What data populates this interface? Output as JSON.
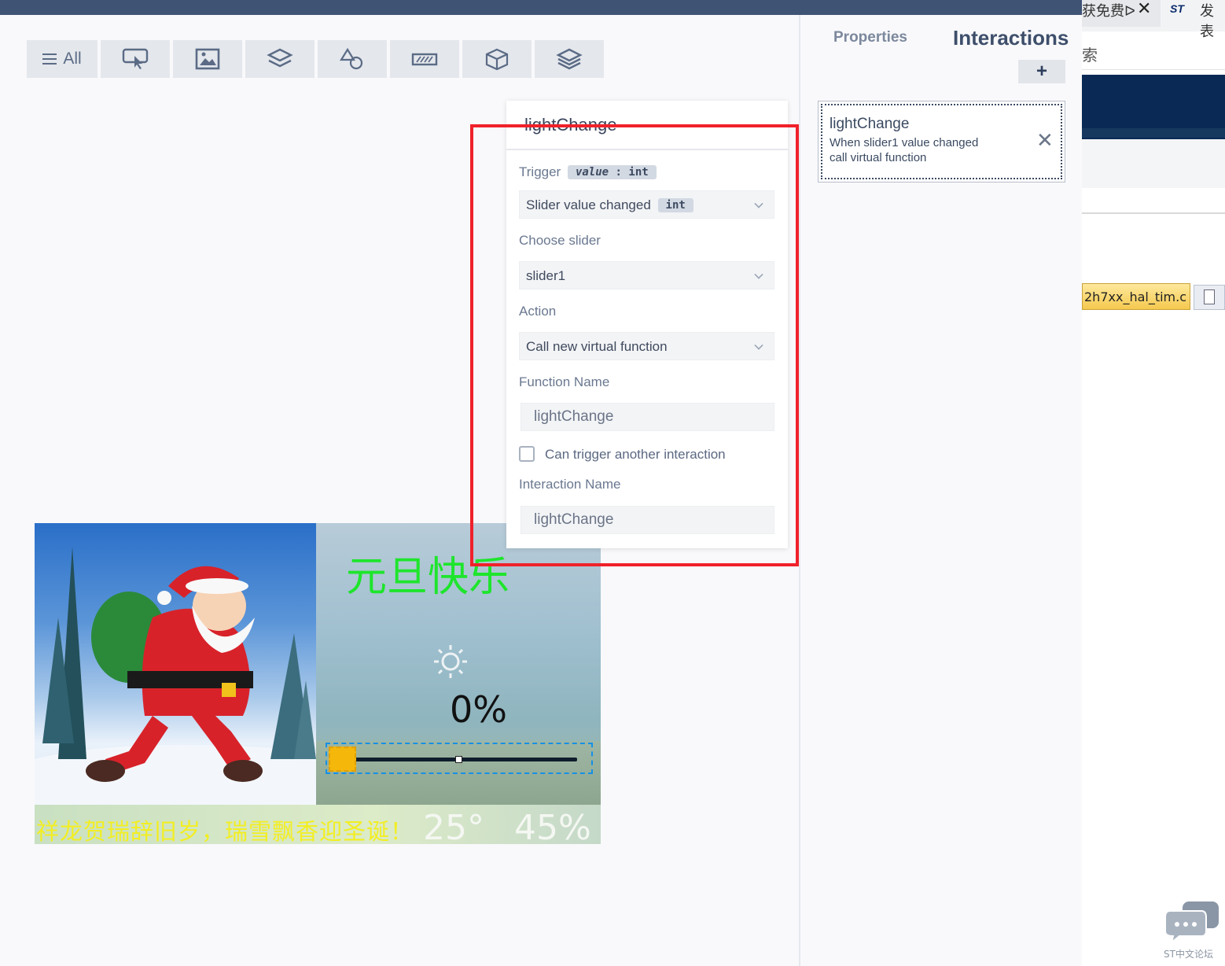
{
  "toolbar": {
    "all_label": "All",
    "items": [
      "interaction-icon",
      "image-icon",
      "layers-icon",
      "shapes-icon",
      "widget-icon",
      "cube-icon",
      "stack-icon"
    ]
  },
  "dialog": {
    "title": "lightChange",
    "trigger_label": "Trigger",
    "trigger_param": "value",
    "trigger_type": "int",
    "trigger_value": "Slider value changed",
    "trigger_value_type": "int",
    "choose_slider_label": "Choose slider",
    "slider_value": "slider1",
    "action_label": "Action",
    "action_value": "Call new virtual function",
    "function_name_label": "Function Name",
    "function_name_value": "lightChange",
    "can_trigger_label": "Can trigger another interaction",
    "interaction_name_label": "Interaction Name",
    "interaction_name_value": "lightChange"
  },
  "screen_preview": {
    "title": "元旦快乐",
    "percent": "0%",
    "banner": "祥龙贺瑞辞旧岁，瑞雪飘香迎圣诞！",
    "temperature": "25°",
    "humidity": "45%",
    "slider_level": 0.0
  },
  "right_panel": {
    "tab_properties": "Properties",
    "tab_interactions": "Interactions",
    "add_label": "+",
    "cards": [
      {
        "title": "lightChange",
        "line1": "When slider1 value changed",
        "line2": "call virtual function",
        "close": "✕"
      }
    ]
  },
  "background_window": {
    "tab1_text": "获免费ᐅ",
    "tab1_close": "✕",
    "st_logo": "ST",
    "tab2_text": "发表",
    "search_text": "索",
    "file_tab": "2h7xx_hal_tim.c",
    "chat_label": "ST中文论坛"
  },
  "colors": {
    "topbar": "#3f5375",
    "highlight": "#f0212a",
    "title_green": "#1ee52c",
    "banner_yellow": "#f2ee22",
    "slider_knob": "#f5b70a"
  }
}
